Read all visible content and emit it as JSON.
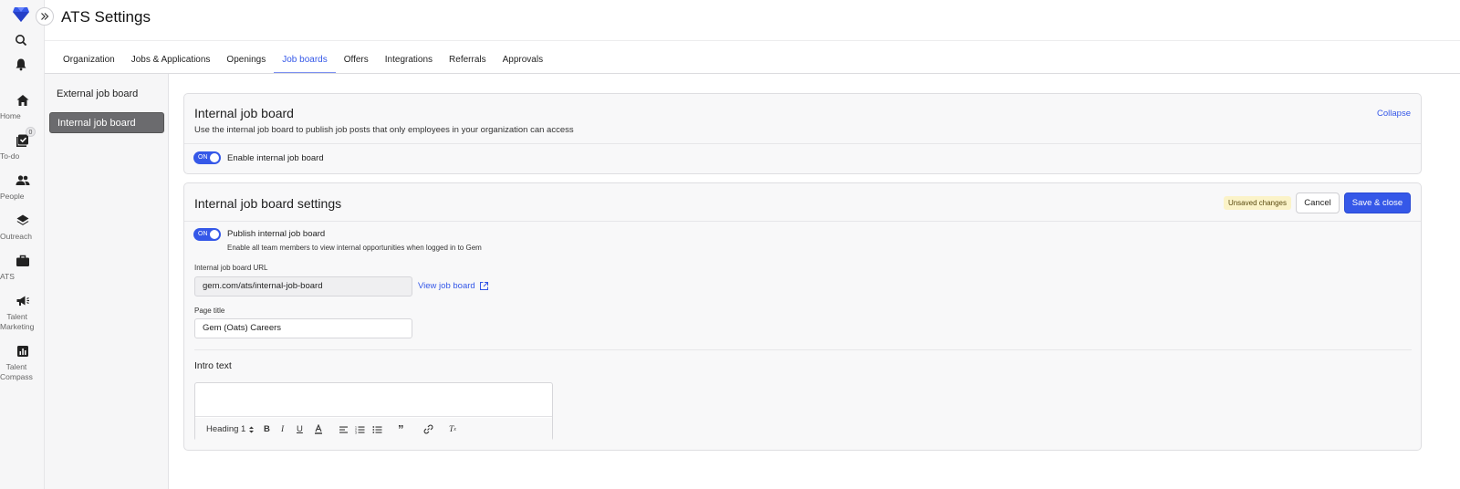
{
  "app": {
    "title": "ATS Settings",
    "accent_color": "#3558e8"
  },
  "rail": {
    "logo_icon": "gem-logo-icon",
    "search_icon": "search-icon",
    "bell_icon": "bell-icon",
    "items": [
      {
        "label": "Home",
        "icon": "home-icon"
      },
      {
        "label": "To-do",
        "icon": "todo-icon",
        "badge": "0"
      },
      {
        "label": "People",
        "icon": "people-icon"
      },
      {
        "label": "Outreach",
        "icon": "layers-icon"
      },
      {
        "label": "ATS",
        "icon": "briefcase-icon"
      },
      {
        "label_line1": "Talent",
        "label_line2": "Marketing",
        "icon": "megaphone-icon"
      },
      {
        "label_line1": "Talent",
        "label_line2": "Compass",
        "icon": "chart-icon"
      }
    ]
  },
  "tabs": [
    "Organization",
    "Jobs & Applications",
    "Openings",
    "Job boards",
    "Offers",
    "Integrations",
    "Referrals",
    "Approvals"
  ],
  "active_tab": "Job boards",
  "subnav": {
    "items": [
      "External job board",
      "Internal job board"
    ],
    "active": "Internal job board"
  },
  "card1": {
    "title": "Internal job board",
    "description": "Use the internal job board to publish job posts that only employees in your organization can access",
    "collapse_label": "Collapse",
    "toggle_state": "ON",
    "toggle_label": "Enable internal job board"
  },
  "card2": {
    "title": "Internal job board settings",
    "unsaved_label": "Unsaved changes",
    "cancel_label": "Cancel",
    "save_label": "Save & close",
    "publish_toggle_state": "ON",
    "publish_label": "Publish internal job board",
    "publish_helper": "Enable all team members to view internal opportunities when logged in to Gem",
    "url_label": "Internal job board URL",
    "url_value": "gem.com/ats/internal-job-board",
    "view_link": "View job board",
    "page_title_label": "Page title",
    "page_title_value": "Gem (Oats) Careers",
    "intro_label": "Intro text",
    "editor": {
      "heading_select": "Heading 1",
      "tools": [
        "bold-icon",
        "italic-icon",
        "underline-icon",
        "text-color-icon",
        "align-icon",
        "ordered-list-icon",
        "bullet-list-icon",
        "quote-icon",
        "link-icon",
        "clear-format-icon"
      ]
    }
  }
}
